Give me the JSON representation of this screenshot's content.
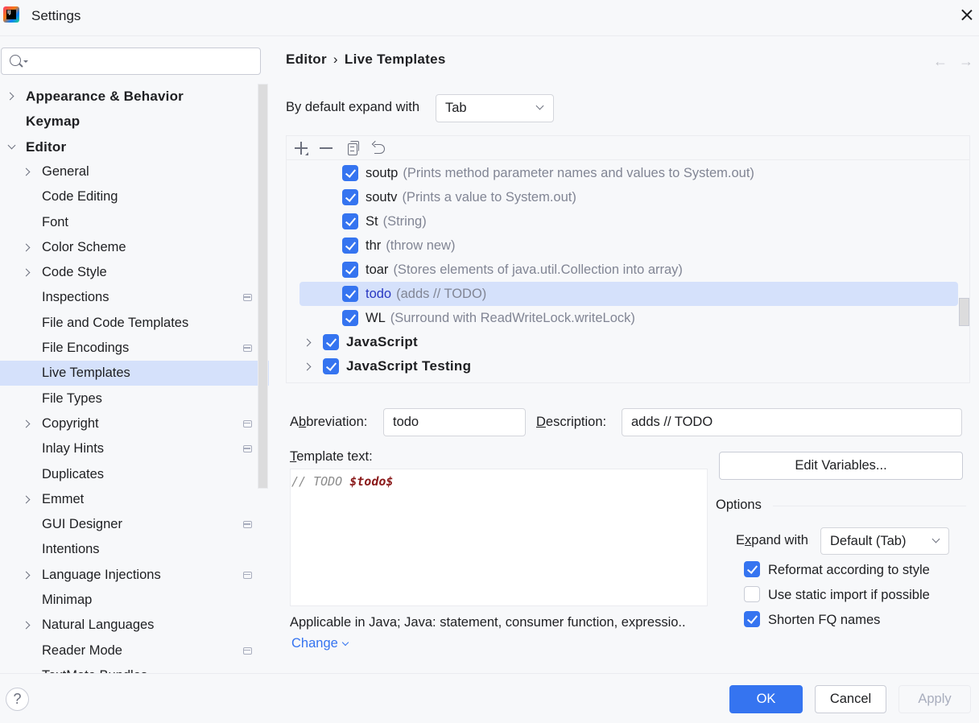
{
  "window": {
    "title": "Settings",
    "app_icon": "intellij-idea-icon",
    "close_icon": "close-icon"
  },
  "sidebar": {
    "search": {
      "placeholder": "",
      "value": ""
    },
    "items": [
      {
        "label": "Appearance & Behavior",
        "level": 0,
        "expander": "collapsed",
        "project_icon": false
      },
      {
        "label": "Keymap",
        "level": 0,
        "expander": "none",
        "project_icon": false
      },
      {
        "label": "Editor",
        "level": 0,
        "expander": "expanded",
        "project_icon": false
      },
      {
        "label": "General",
        "level": 1,
        "expander": "collapsed",
        "project_icon": false
      },
      {
        "label": "Code Editing",
        "level": 1,
        "expander": "none",
        "project_icon": false
      },
      {
        "label": "Font",
        "level": 1,
        "expander": "none",
        "project_icon": false
      },
      {
        "label": "Color Scheme",
        "level": 1,
        "expander": "collapsed",
        "project_icon": false
      },
      {
        "label": "Code Style",
        "level": 1,
        "expander": "collapsed",
        "project_icon": false
      },
      {
        "label": "Inspections",
        "level": 1,
        "expander": "none",
        "project_icon": true
      },
      {
        "label": "File and Code Templates",
        "level": 1,
        "expander": "none",
        "project_icon": false
      },
      {
        "label": "File Encodings",
        "level": 1,
        "expander": "none",
        "project_icon": true
      },
      {
        "label": "Live Templates",
        "level": 1,
        "expander": "none",
        "project_icon": false,
        "selected": true
      },
      {
        "label": "File Types",
        "level": 1,
        "expander": "none",
        "project_icon": false
      },
      {
        "label": "Copyright",
        "level": 1,
        "expander": "collapsed",
        "project_icon": true
      },
      {
        "label": "Inlay Hints",
        "level": 1,
        "expander": "none",
        "project_icon": true
      },
      {
        "label": "Duplicates",
        "level": 1,
        "expander": "none",
        "project_icon": false
      },
      {
        "label": "Emmet",
        "level": 1,
        "expander": "collapsed",
        "project_icon": false
      },
      {
        "label": "GUI Designer",
        "level": 1,
        "expander": "none",
        "project_icon": true
      },
      {
        "label": "Intentions",
        "level": 1,
        "expander": "none",
        "project_icon": false
      },
      {
        "label": "Language Injections",
        "level": 1,
        "expander": "collapsed",
        "project_icon": true
      },
      {
        "label": "Minimap",
        "level": 1,
        "expander": "none",
        "project_icon": false
      },
      {
        "label": "Natural Languages",
        "level": 1,
        "expander": "collapsed",
        "project_icon": false
      },
      {
        "label": "Reader Mode",
        "level": 1,
        "expander": "none",
        "project_icon": true
      },
      {
        "label": "TextMate Bundles",
        "level": 1,
        "expander": "none",
        "project_icon": false
      }
    ]
  },
  "breadcrumb": {
    "parent": "Editor",
    "separator": "›",
    "current": "Live Templates"
  },
  "nav": {
    "back": "←",
    "forward": "→"
  },
  "expand_default": {
    "label": "By default expand with",
    "value": "Tab"
  },
  "toolbar": {
    "add": "add-icon",
    "remove": "remove-icon",
    "copy": "copy-icon",
    "restore": "restore-icon"
  },
  "templates": [
    {
      "abbr": "soutp",
      "desc": "(Prints method parameter names and values to System.out)",
      "checked": true,
      "type": "item"
    },
    {
      "abbr": "soutv",
      "desc": "(Prints a value to System.out)",
      "checked": true,
      "type": "item"
    },
    {
      "abbr": "St",
      "desc": "(String)",
      "checked": true,
      "type": "item"
    },
    {
      "abbr": "thr",
      "desc": "(throw new)",
      "checked": true,
      "type": "item"
    },
    {
      "abbr": "toar",
      "desc": "(Stores elements of java.util.Collection into array)",
      "checked": true,
      "type": "item"
    },
    {
      "abbr": "todo",
      "desc": "(adds // TODO)",
      "checked": true,
      "type": "item",
      "selected": true
    },
    {
      "abbr": "WL",
      "desc": "(Surround with ReadWriteLock.writeLock)",
      "checked": true,
      "type": "item"
    },
    {
      "abbr": "JavaScript",
      "desc": "",
      "checked": true,
      "type": "group"
    },
    {
      "abbr": "JavaScript Testing",
      "desc": "",
      "checked": true,
      "type": "group"
    }
  ],
  "editor": {
    "abbreviation_label": {
      "pre": "A",
      "mnemonic": "b",
      "post": "breviation:"
    },
    "abbreviation": "todo",
    "description_label": {
      "pre": "",
      "mnemonic": "D",
      "post": "escription:"
    },
    "description": "adds // TODO",
    "template_text_label": {
      "pre": "",
      "mnemonic": "T",
      "post": "emplate text:"
    },
    "template_text": {
      "comment": "// TODO ",
      "variable": "$todo$"
    },
    "edit_variables": "Edit Variables...",
    "applicable": "Applicable in Java; Java: statement, consumer function, expressio..",
    "change": "Change"
  },
  "options": {
    "title": "Options",
    "expand_label": {
      "pre": "E",
      "mnemonic": "x",
      "post": "pand with"
    },
    "expand_value": "Default (Tab)",
    "checkboxes": [
      {
        "label": "Reformat according to style",
        "checked": true
      },
      {
        "label": "Use static import if possible",
        "checked": false
      },
      {
        "label": "Shorten FQ names",
        "checked": true
      }
    ]
  },
  "footer": {
    "help": "?",
    "ok": "OK",
    "cancel": "Cancel",
    "apply": "Apply"
  }
}
